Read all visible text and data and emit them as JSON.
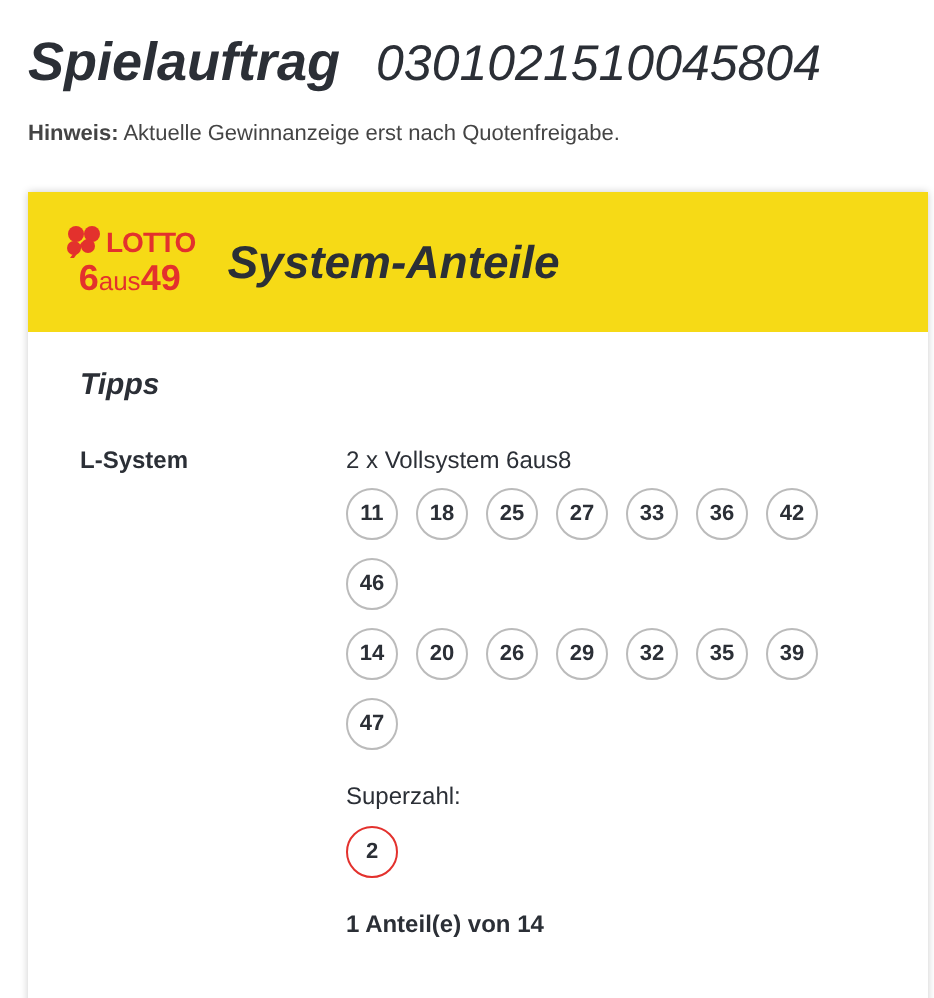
{
  "page": {
    "title": "Spielauftrag",
    "number": "0301021510045804",
    "notice_label": "Hinweis:",
    "notice_text": "Aktuelle Gewinnanzeige erst nach Quotenfreigabe."
  },
  "card": {
    "logo_top": "LOTTO",
    "logo_bottom_a": "6",
    "logo_bottom_b": "aus",
    "logo_bottom_c": "49",
    "title": "System-Anteile"
  },
  "tipps": {
    "heading": "Tipps",
    "label": "L-System",
    "system": "2 x Vollsystem 6aus8",
    "groups": [
      [
        "11",
        "18",
        "25",
        "27",
        "33",
        "36",
        "42",
        "46"
      ],
      [
        "14",
        "20",
        "26",
        "29",
        "32",
        "35",
        "39",
        "47"
      ]
    ],
    "superzahl_label": "Superzahl:",
    "superzahl": "2",
    "shares": "1 Anteil(e) von 14"
  }
}
